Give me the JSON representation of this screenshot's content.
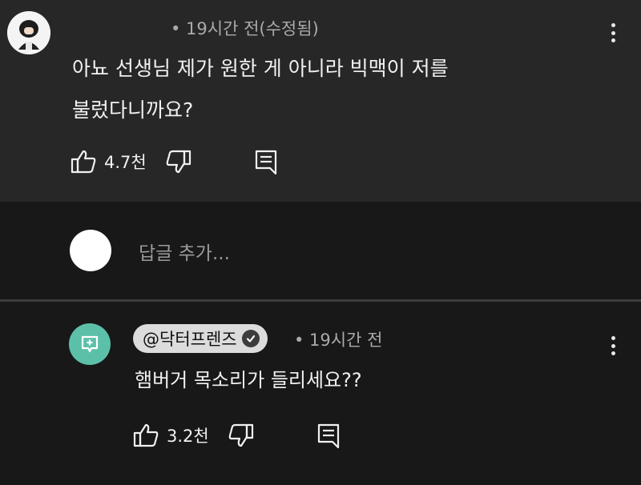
{
  "top_comment": {
    "meta": "• 19시간 전(수정됨)",
    "text": "아뇨 선생님 제가 원한 게 아니라 빅맥이 저를\n불렀다니까요?",
    "like_count": "4.7천"
  },
  "reply_box": {
    "placeholder": "답글 추가..."
  },
  "reply_comment": {
    "channel": "@닥터프렌즈",
    "meta": "• 19시간 전",
    "text": "햄버거 목소리가 들리세요??",
    "like_count": "3.2천"
  },
  "colors": {
    "top_bg": "#272727",
    "page_bg": "#181818",
    "avatar_green": "#5cc0a9",
    "pill_bg": "#dcdcdc"
  },
  "icons": {
    "like": "thumbs-up-icon",
    "dislike": "thumbs-down-icon",
    "reply": "reply-icon",
    "more": "more-vert-icon",
    "verified": "verified-check-icon"
  }
}
